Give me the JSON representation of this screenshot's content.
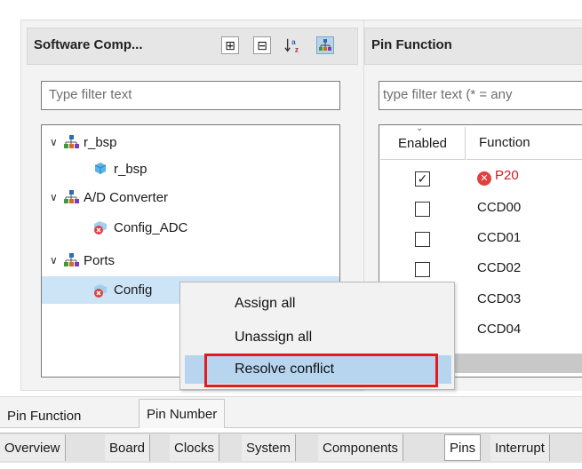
{
  "left_panel": {
    "title": "Software Comp...",
    "toolbar": {
      "expand_icon": "⊞",
      "collapse_icon": "⊟",
      "sort_icon": "↓ᵃ_z",
      "hierarchy_icon": "品"
    },
    "filter_placeholder": "Type filter text",
    "tree": [
      {
        "label": "r_bsp",
        "expanded": true,
        "level": 0,
        "icon": "component-group-icon"
      },
      {
        "label": "r_bsp",
        "level": 1,
        "icon": "cube-icon"
      },
      {
        "label": "A/D Converter",
        "expanded": true,
        "level": 0,
        "icon": "component-group-icon"
      },
      {
        "label": "Config_ADC",
        "level": 1,
        "icon": "config-error-icon"
      },
      {
        "label": "Ports",
        "expanded": true,
        "level": 0,
        "icon": "component-group-icon"
      },
      {
        "label": "Config",
        "level": 1,
        "icon": "config-error-icon",
        "selected": true
      }
    ]
  },
  "right_panel": {
    "title": "Pin Function",
    "filter_placeholder": "type filter text (* = any",
    "columns": [
      "Enabled",
      "Function"
    ],
    "rows": [
      {
        "checked": true,
        "function": "P20",
        "error": true
      },
      {
        "checked": false,
        "function": "CCD00"
      },
      {
        "checked": false,
        "function": "CCD01"
      },
      {
        "checked": false,
        "function": "CCD02"
      },
      {
        "checked": false,
        "function": "CCD03"
      },
      {
        "checked": false,
        "function": "CCD04"
      }
    ]
  },
  "context_menu": {
    "items": [
      "Assign all",
      "Unassign all",
      "Resolve conflict"
    ],
    "highlighted": "Resolve conflict"
  },
  "sub_tabs": [
    "Pin Function",
    "Pin Number"
  ],
  "main_tabs": [
    "Overview",
    "Board",
    "Clocks",
    "System",
    "Components",
    "Pins",
    "Interrupt"
  ],
  "colors": {
    "selection": "#cde3f6",
    "menu_highlight": "#b7d5ef",
    "callout": "#e31b1b",
    "error": "#e04040"
  }
}
